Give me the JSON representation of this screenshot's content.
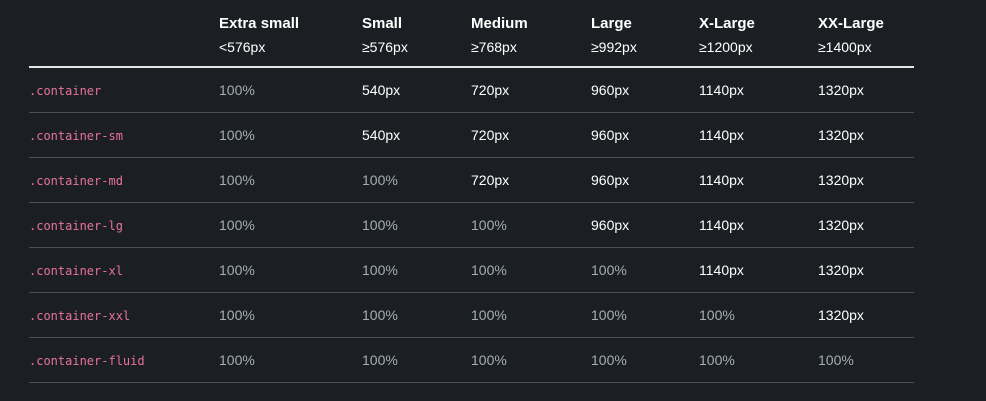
{
  "table": {
    "header": {
      "first": "",
      "breakpoints": [
        {
          "name": "Extra small",
          "dim": "<576px"
        },
        {
          "name": "Small",
          "dim": "≥576px"
        },
        {
          "name": "Medium",
          "dim": "≥768px"
        },
        {
          "name": "Large",
          "dim": "≥992px"
        },
        {
          "name": "X-Large",
          "dim": "≥1200px"
        },
        {
          "name": "XX-Large",
          "dim": "≥1400px"
        }
      ]
    },
    "rows": [
      {
        "class_name": ".container",
        "values": [
          "100%",
          "540px",
          "720px",
          "960px",
          "1140px",
          "1320px"
        ]
      },
      {
        "class_name": ".container-sm",
        "values": [
          "100%",
          "540px",
          "720px",
          "960px",
          "1140px",
          "1320px"
        ]
      },
      {
        "class_name": ".container-md",
        "values": [
          "100%",
          "100%",
          "720px",
          "960px",
          "1140px",
          "1320px"
        ]
      },
      {
        "class_name": ".container-lg",
        "values": [
          "100%",
          "100%",
          "100%",
          "960px",
          "1140px",
          "1320px"
        ]
      },
      {
        "class_name": ".container-xl",
        "values": [
          "100%",
          "100%",
          "100%",
          "100%",
          "1140px",
          "1320px"
        ]
      },
      {
        "class_name": ".container-xxl",
        "values": [
          "100%",
          "100%",
          "100%",
          "100%",
          "100%",
          "1320px"
        ]
      },
      {
        "class_name": ".container-fluid",
        "values": [
          "100%",
          "100%",
          "100%",
          "100%",
          "100%",
          "100%"
        ]
      }
    ]
  },
  "colors": {
    "background": "#1b1f23",
    "class_name": "#e8729a",
    "value_fixed": "#ffffff",
    "value_full": "#a4aeb6",
    "header_rule": "#e6e6e6",
    "row_rule": "#4a4f55"
  }
}
